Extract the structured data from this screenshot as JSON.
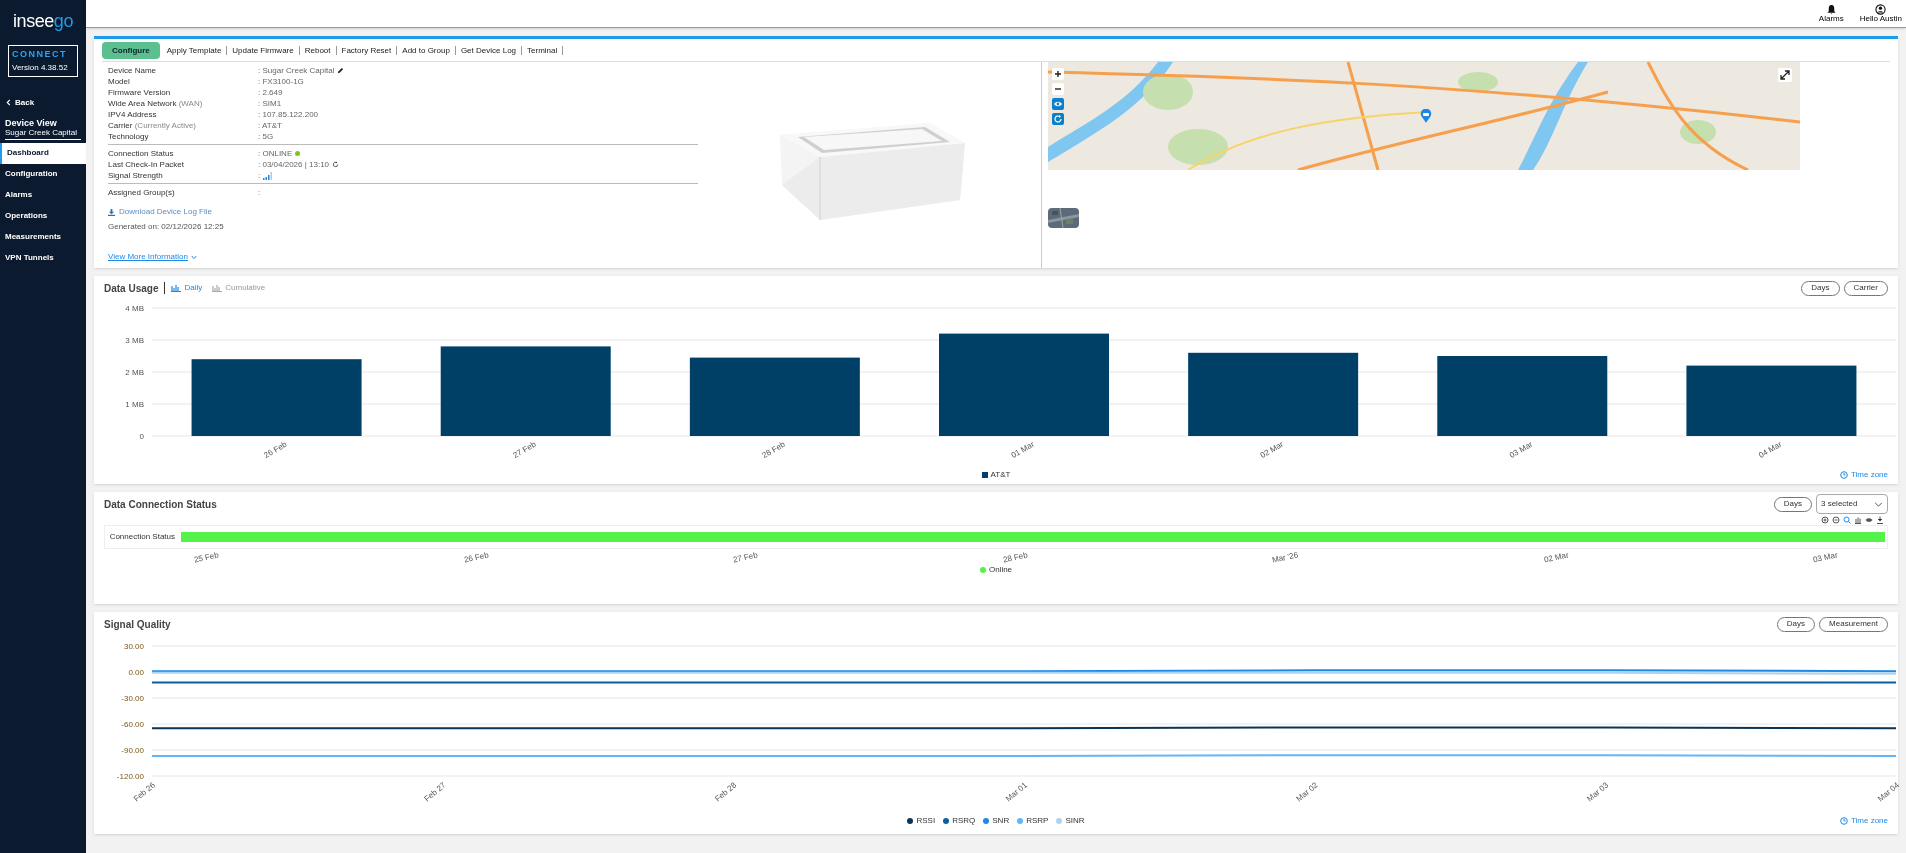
{
  "sidebar": {
    "logo": {
      "main": "insee",
      "accent": "go"
    },
    "product": {
      "name": "CONNECT",
      "version": "Version 4.38.52"
    },
    "back": "Back",
    "section": {
      "title": "Device View",
      "subtitle": "Sugar Creek Capital"
    },
    "items": [
      {
        "label": "Dashboard",
        "selected": true
      },
      {
        "label": "Configuration",
        "selected": false
      },
      {
        "label": "Alarms",
        "selected": false
      },
      {
        "label": "Operations",
        "selected": false
      },
      {
        "label": "Measurements",
        "selected": false
      },
      {
        "label": "VPN Tunnels",
        "selected": false
      }
    ]
  },
  "header": {
    "alarms": "Alarms",
    "user": "Hello Austin"
  },
  "toolbar": [
    {
      "label": "Configure",
      "selected": true
    },
    {
      "label": "Apply Template",
      "selected": false
    },
    {
      "label": "Update Firmware",
      "selected": false
    },
    {
      "label": "Reboot",
      "selected": false
    },
    {
      "label": "Factory Reset",
      "selected": false
    },
    {
      "label": "Add to Group",
      "selected": false
    },
    {
      "label": "Get Device Log",
      "selected": false
    },
    {
      "label": "Terminal",
      "selected": false
    }
  ],
  "device_info": [
    [
      {
        "label": "Device Name",
        "value": ": Sugar Creek Capital",
        "kind": "editable"
      },
      {
        "label": "Model",
        "value": ": FX3100-1G",
        "kind": "text"
      },
      {
        "label": "Firmware Version",
        "value": ": 2.649",
        "kind": "text"
      },
      {
        "label": "Wide Area Network",
        "note": "(WAN)",
        "value": ": SIM1",
        "kind": "text"
      },
      {
        "label": "IPV4 Address",
        "value": ": 107.85.122.200",
        "kind": "text"
      },
      {
        "label": "Carrier",
        "note": "(Currently Active)",
        "value": ": AT&T",
        "kind": "text"
      },
      {
        "label": "Technology",
        "value": ": 5G",
        "kind": "text"
      }
    ],
    [
      {
        "label": "Connection Status",
        "value": ": ONLINE",
        "kind": "status",
        "color": "#7cc520"
      },
      {
        "label": "Last Check-In Packet",
        "value": ": 03/04/2026 | 13:10",
        "kind": "refresh"
      },
      {
        "label": "Signal Strength",
        "value": ":",
        "kind": "signal"
      }
    ],
    [
      {
        "label": "Assigned Group(s)",
        "value": ":",
        "kind": "text"
      }
    ]
  ],
  "download_link": "Download Device Log File",
  "generated": "Generated on: 02/12/2026 12:25",
  "more_link": "View More Information",
  "data_usage": {
    "title": "Data Usage",
    "views": [
      {
        "label": "Daily",
        "selected": true
      },
      {
        "label": "Cumulative",
        "selected": false
      }
    ],
    "filters": [
      "Days",
      "Carrier"
    ],
    "time_zone": "Time zone",
    "chart_data": {
      "type": "bar",
      "categories": [
        "26 Feb",
        "27 Feb",
        "28 Feb",
        "01 Mar",
        "02 Mar",
        "03 Mar",
        "04 Mar"
      ],
      "series": [
        {
          "name": "AT&T",
          "color": "#003f66",
          "values": [
            2.4,
            2.8,
            2.45,
            3.2,
            2.6,
            2.5,
            2.2
          ]
        }
      ],
      "ylim": [
        0,
        4
      ],
      "grid": true,
      "yticks": [
        {
          "value": 0,
          "label": "0"
        },
        {
          "value": 1,
          "label": "1 MB"
        },
        {
          "value": 2,
          "label": "2 MB"
        },
        {
          "value": 3,
          "label": "3 MB"
        },
        {
          "value": 4,
          "label": "4 MB"
        }
      ]
    }
  },
  "connection_status": {
    "title": "Data Connection Status",
    "filters": [
      "Days"
    ],
    "select": "3 selected",
    "row_label": "Connection Status",
    "x_labels": [
      "25 Feb",
      "26 Feb",
      "27 Feb",
      "28 Feb",
      "Mar '26",
      "02 Mar",
      "03 Mar"
    ],
    "legend": [
      {
        "label": "Online",
        "color": "#55f24a"
      }
    ]
  },
  "signal_quality": {
    "title": "Signal Quality",
    "filters": [
      "Days",
      "Measurement"
    ],
    "time_zone": "Time zone",
    "chart_data": {
      "type": "line",
      "categories": [
        "Feb 26",
        "Feb 27",
        "Feb 28",
        "Mar 01",
        "Mar 02",
        "Mar 03",
        "Mar 04"
      ],
      "series": [
        {
          "name": "RSSI",
          "color": "#0b3556",
          "values": [
            -65,
            -65,
            -65,
            -65,
            -64,
            -64,
            -65
          ]
        },
        {
          "name": "RSRQ",
          "color": "#0a5fa3",
          "values": [
            -12,
            -12,
            -12,
            -12,
            -12,
            -12,
            -12
          ]
        },
        {
          "name": "SNR",
          "color": "#1e88e5",
          "values": [
            1,
            1,
            1,
            1,
            2,
            2,
            1
          ]
        },
        {
          "name": "RSRP",
          "color": "#64b5f6",
          "values": [
            -97,
            -97,
            -97,
            -97,
            -96,
            -96,
            -97
          ]
        },
        {
          "name": "SINR",
          "color": "#a9d4f5",
          "values": [
            -1,
            -1,
            -1,
            -1,
            -1,
            -1,
            -2
          ]
        }
      ],
      "ylim": [
        -120,
        30
      ],
      "grid": true,
      "yticks": [
        {
          "value": 30,
          "label": "30.00"
        },
        {
          "value": 0,
          "label": "0.00"
        },
        {
          "value": -30,
          "label": "-30.00"
        },
        {
          "value": -60,
          "label": "-60.00"
        },
        {
          "value": -90,
          "label": "-90.00"
        },
        {
          "value": -120,
          "label": "-120.00"
        }
      ]
    }
  }
}
